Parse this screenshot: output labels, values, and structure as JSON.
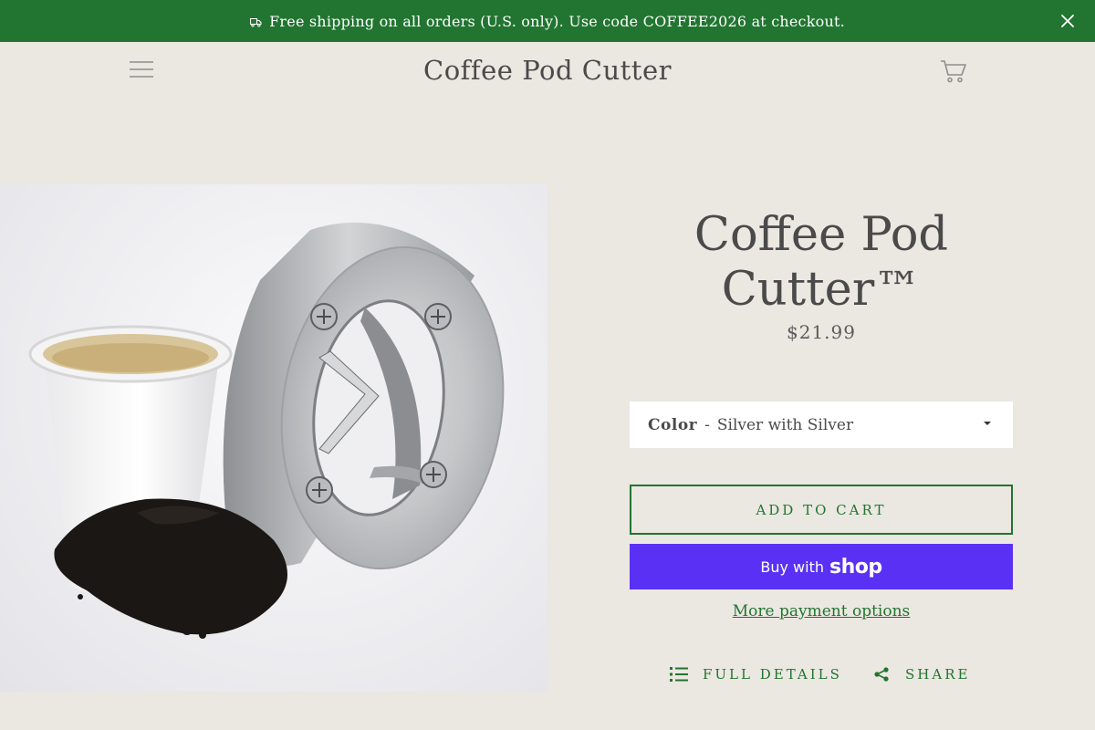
{
  "announcement": {
    "text": "Free shipping on all orders (U.S. only). Use code COFFEE2026 at checkout.",
    "icon": "truck-icon",
    "close_icon": "close-icon",
    "background": "#217530"
  },
  "header": {
    "menu_icon": "hamburger-menu-icon",
    "site_title": "Coffee Pod Cutter",
    "cart_icon": "cart-icon"
  },
  "product": {
    "title": "Coffee Pod Cutter™",
    "price": "$21.99",
    "variant": {
      "label": "Color",
      "separator": "-",
      "selected": "Silver with Silver"
    },
    "add_to_cart_label": "ADD TO CART",
    "buy_with_label": "Buy with",
    "shop_logo": "shop",
    "more_payment_label": "More payment options",
    "full_details_label": "FULL DETAILS",
    "share_label": "SHARE"
  },
  "colors": {
    "accent_green": "#217530",
    "shop_pay_purple": "#5a31f4",
    "page_background": "#ebe7e1"
  }
}
